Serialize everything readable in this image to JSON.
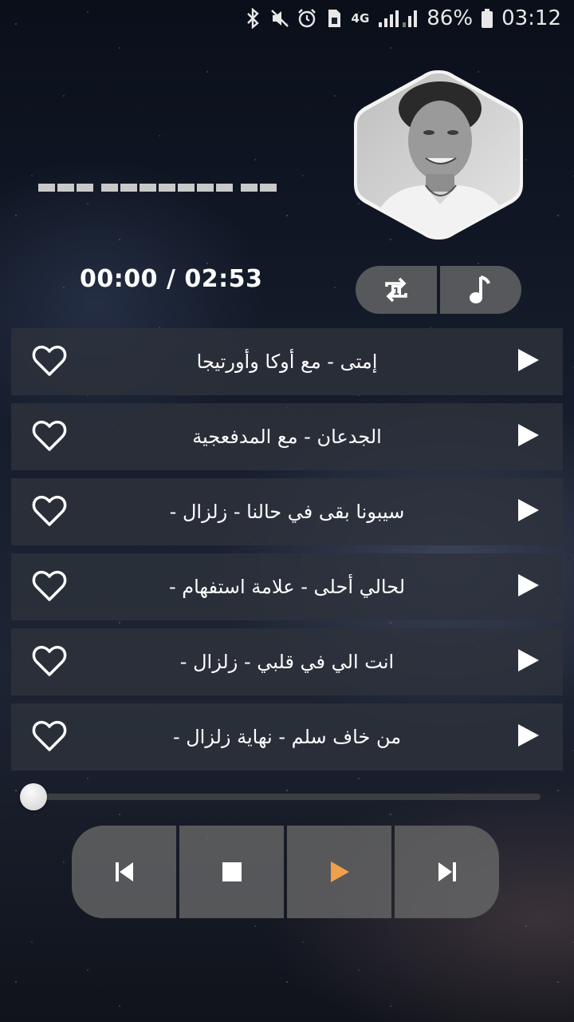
{
  "status_bar": {
    "network": "4G",
    "battery_percent": "86%",
    "time": "03:12",
    "icons": [
      "bluetooth-icon",
      "mute-icon",
      "alarm-icon",
      "sim-icon",
      "signal-icon",
      "battery-icon"
    ]
  },
  "player": {
    "time_readout": "00:00 / 02:53",
    "progress": 0,
    "modes": [
      {
        "name": "repeat-one-icon"
      },
      {
        "name": "music-note-icon"
      }
    ]
  },
  "tracks": [
    {
      "title": "إمتى - مع أوكا وأورتيجا"
    },
    {
      "title": "الجدعان - مع المدفعجية"
    },
    {
      "title": "سيبونا بقى في حالنا - زلزال -"
    },
    {
      "title": "لحالي أحلى - علامة استفهام -"
    },
    {
      "title": "انت الي في قلبي - زلزال -"
    },
    {
      "title": "من خاف سلم - نهاية زلزال -"
    }
  ],
  "transport": {
    "buttons": [
      "skip-previous-icon",
      "stop-icon",
      "play-icon",
      "skip-next-icon"
    ],
    "accent_color": "#f0a04a"
  },
  "colors": {
    "row_bg": "#2d323c",
    "control_bg": "#696969"
  }
}
